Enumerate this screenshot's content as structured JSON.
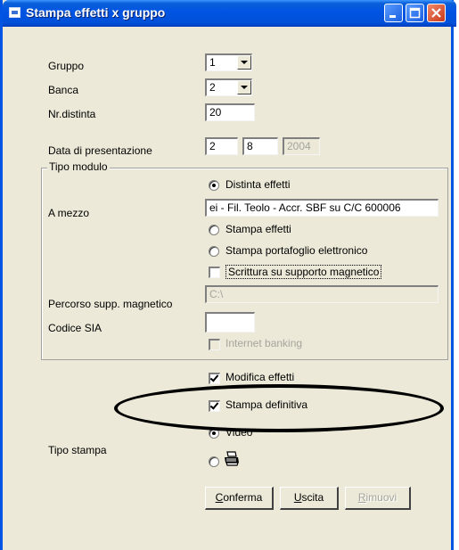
{
  "window": {
    "title": "Stampa effetti x gruppo",
    "controls": {
      "minimize": "minimize",
      "maximize": "maximize",
      "close": "close"
    }
  },
  "form": {
    "gruppo": {
      "label": "Gruppo",
      "value": "1"
    },
    "banca": {
      "label": "Banca",
      "value": "2"
    },
    "nr_distinta": {
      "label": "Nr.distinta",
      "value": "20"
    },
    "data_presentazione": {
      "label": "Data di presentazione",
      "day": "2",
      "month": "8",
      "year": "2004"
    },
    "tipo_modulo": {
      "label": "Tipo modulo",
      "options": {
        "distinta_effetti": "Distinta effetti",
        "stampa_effetti": "Stampa effetti",
        "stampa_portafoglio": "Stampa portafoglio elettronico"
      },
      "selected": "Distinta effetti",
      "a_mezzo_label": "A mezzo",
      "a_mezzo_value": "ei - Fil. Teolo - Accr. SBF su C/C 600006",
      "scrittura_supporto": "Scrittura su supporto magnetico",
      "percorso_label": "Percorso supp. magnetico",
      "percorso_value": "C:\\",
      "codice_sia_label": "Codice SIA",
      "codice_sia_value": "",
      "internet_banking": "Internet banking"
    },
    "modifica_effetti": "Modifica effetti",
    "stampa_definitiva": "Stampa definitiva",
    "tipo_stampa": {
      "label": "Tipo stampa",
      "video": "Video",
      "printer_icon": "printer-icon"
    }
  },
  "buttons": {
    "conferma": {
      "accel": "C",
      "rest": "onferma"
    },
    "uscita": {
      "accel": "U",
      "rest": "scita"
    },
    "rimuovi": {
      "accel": "R",
      "rest": "imuovi"
    }
  },
  "colors": {
    "titlebar": "#0054e3",
    "window_bg": "#ece9d8",
    "close_button": "#c8391a"
  }
}
